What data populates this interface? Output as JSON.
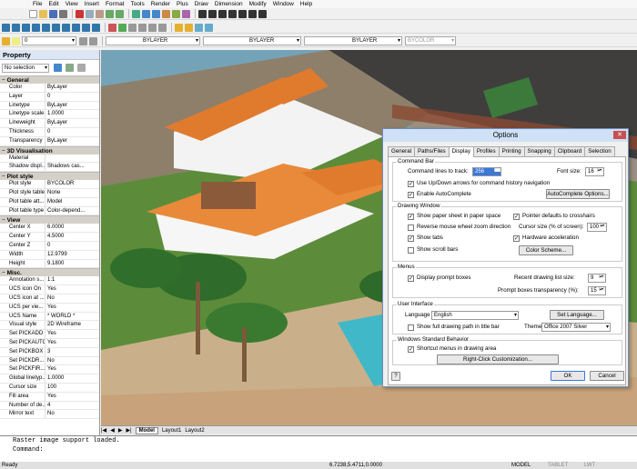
{
  "menu": [
    "File",
    "Edit",
    "View",
    "Insert",
    "Format",
    "Tools",
    "Render",
    "Plus",
    "Draw",
    "Dimension",
    "Modify",
    "Window",
    "Help"
  ],
  "toolbar": {
    "layer": "0",
    "color": "BYLAYER",
    "linetype": "BYLAYER",
    "lineweight": "BYLAYER",
    "plotstyle": "BYCOLOR"
  },
  "property": {
    "title": "Property",
    "selection": "No selection",
    "sections": [
      {
        "name": "General",
        "rows": [
          [
            "Color",
            "ByLayer"
          ],
          [
            "Layer",
            "0"
          ],
          [
            "Linetype",
            "ByLayer"
          ],
          [
            "Linetype scale",
            "1.0000"
          ],
          [
            "Lineweight",
            "ByLayer"
          ],
          [
            "Thickness",
            "0"
          ],
          [
            "Transparency",
            "ByLayer"
          ]
        ]
      },
      {
        "name": "3D Visualisation",
        "rows": [
          [
            "Material",
            ""
          ],
          [
            "Shadow displ...",
            "Shadows cas..."
          ]
        ]
      },
      {
        "name": "Plot style",
        "rows": [
          [
            "Plot style",
            "BYCOLOR"
          ],
          [
            "Plot style table",
            "None"
          ],
          [
            "Plot table att...",
            "Model"
          ],
          [
            "Plot table type",
            "Color-depend..."
          ]
        ]
      },
      {
        "name": "View",
        "rows": [
          [
            "Center X",
            "6.0000"
          ],
          [
            "Center Y",
            "4.5000"
          ],
          [
            "Center Z",
            "0"
          ],
          [
            "Width",
            "12.9799"
          ],
          [
            "Height",
            "9.1800"
          ]
        ]
      },
      {
        "name": "Misc.",
        "rows": [
          [
            "Annotation s...",
            "1:1"
          ],
          [
            "UCS icon On",
            "Yes"
          ],
          [
            "UCS icon at ...",
            "No"
          ],
          [
            "UCS per vie...",
            "Yes"
          ],
          [
            "UCS Name",
            "* WORLD *"
          ],
          [
            "Visual style",
            "2D Wireframe"
          ],
          [
            "Set PICKADD",
            "Yes"
          ],
          [
            "Set PICKAUTO",
            "Yes"
          ],
          [
            "Set PICKBOX",
            "3"
          ],
          [
            "Set PICKDR...",
            "No"
          ],
          [
            "Set PICKFIR...",
            "Yes"
          ],
          [
            "Global linetyp...",
            "1.0000"
          ],
          [
            "Cursor size",
            "100"
          ],
          [
            "Fill area",
            "Yes"
          ],
          [
            "Number of de...",
            "4"
          ],
          [
            "Mirror text",
            "No"
          ]
        ]
      }
    ]
  },
  "tabs": [
    "Model",
    "Layout1",
    "Layout2"
  ],
  "cmd": {
    "history": "Raster image support loaded.",
    "prompt": "Command:"
  },
  "status": {
    "left": "Ready",
    "coords": "6.7238,5.4711,0.0000",
    "items": [
      "MODEL",
      "TABLET",
      "LWT"
    ]
  },
  "dialog": {
    "title": "Options",
    "tabs": [
      "General",
      "Paths/Files",
      "Display",
      "Profiles",
      "Printing",
      "Snapping",
      "Clipboard",
      "Selection"
    ],
    "active_tab": "Display",
    "command_bar": {
      "title": "Command Bar",
      "lines_label": "Command lines to track:",
      "lines_value": "256",
      "font_label": "Font size:",
      "font_value": "16",
      "updown": "Use Up/Down arrows for command history navigation",
      "autocomplete": "Enable AutoComplete",
      "ac_options": "AutoComplete Options..."
    },
    "drawing_window": {
      "title": "Drawing Window",
      "paper": "Show paper sheet in paper space",
      "pointer": "Pointer defaults to crosshairs",
      "reverse": "Reverse mouse wheel zoom direction",
      "cursor_label": "Cursor size (% of screen):",
      "cursor_value": "100",
      "showtabs": "Show tabs",
      "hwaccel": "Hardware acceleration",
      "scrollbars": "Show scroll bars",
      "scheme": "Color Scheme..."
    },
    "menus": {
      "title": "Menus",
      "prompt": "Display prompt boxes",
      "recent_label": "Recent drawing list size:",
      "recent_value": "9",
      "transp_label": "Prompt boxes transparency (%):",
      "transp_value": "15"
    },
    "ui": {
      "title": "User Interface",
      "lang_label": "Language",
      "lang_value": "English",
      "set_lang": "Set Language...",
      "fullpath": "Show full drawing path in title bar",
      "theme_label": "Theme",
      "theme_value": "Office 2007 Silver"
    },
    "wsb": {
      "title": "Windows Standard Behavior",
      "shortcut": "Shortcut menus in drawing area",
      "rcc": "Right-Click Customization..."
    },
    "ok": "OK",
    "cancel": "Cancel",
    "help": "?"
  },
  "colors": {
    "accent": "#2d6cb5",
    "sky": "#6f9fb4"
  }
}
